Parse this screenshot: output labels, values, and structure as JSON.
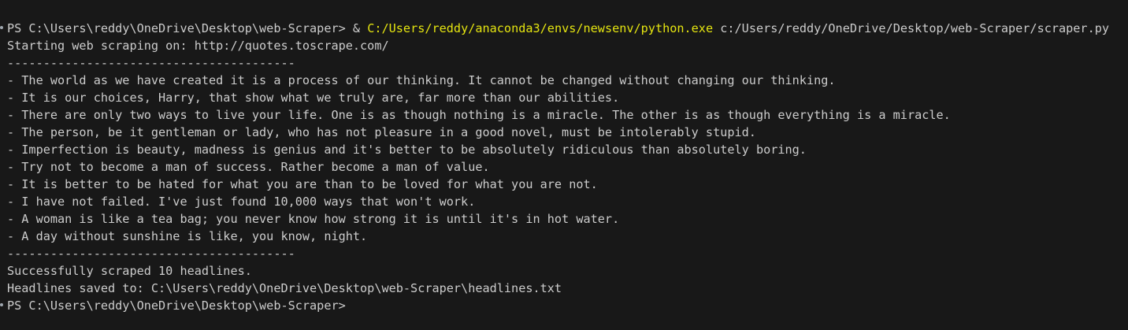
{
  "terminal": {
    "prompt_1": "PS C:\\Users\\reddy\\OneDrive\\Desktop\\web-Scraper> ",
    "command": {
      "operator": "& ",
      "executable": "C:/Users/reddy/anaconda3/envs/newsenv/python.exe",
      "argument": " c:/Users/reddy/OneDrive/Desktop/web-Scraper/scraper.py"
    },
    "output": [
      "Starting web scraping on: http://quotes.toscrape.com/",
      "----------------------------------------",
      "- The world as we have created it is a process of our thinking. It cannot be changed without changing our thinking.",
      "- It is our choices, Harry, that show what we truly are, far more than our abilities.",
      "- There are only two ways to live your life. One is as though nothing is a miracle. The other is as though everything is a miracle.",
      "- The person, be it gentleman or lady, who has not pleasure in a good novel, must be intolerably stupid.",
      "- Imperfection is beauty, madness is genius and it's better to be absolutely ridiculous than absolutely boring.",
      "- Try not to become a man of success. Rather become a man of value.",
      "- It is better to be hated for what you are than to be loved for what you are not.",
      "- I have not failed. I've just found 10,000 ways that won't work.",
      "- A woman is like a tea bag; you never know how strong it is until it's in hot water.",
      "- A day without sunshine is like, you know, night.",
      "----------------------------------------",
      "Successfully scraped 10 headlines.",
      "Headlines saved to: C:\\Users\\reddy\\OneDrive\\Desktop\\web-Scraper\\headlines.txt"
    ],
    "prompt_2": "PS C:\\Users\\reddy\\OneDrive\\Desktop\\web-Scraper>"
  },
  "colors": {
    "background": "#181818",
    "text": "#cccccc",
    "executable": "#e5e510",
    "marker": "#9ea6ae"
  }
}
